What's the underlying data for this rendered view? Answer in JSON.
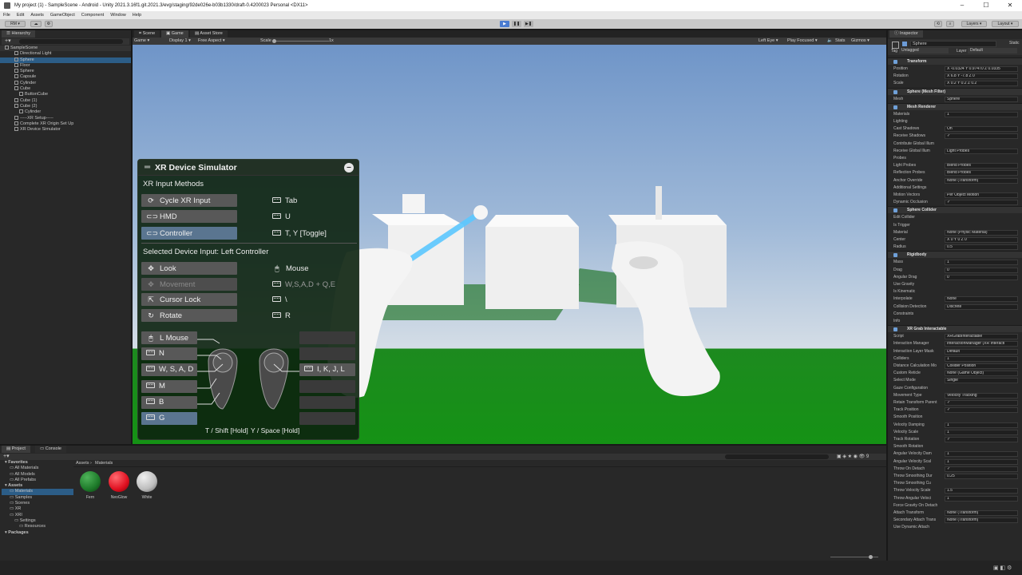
{
  "window": {
    "title": "My project (1) - SampleScene - Android - Unity 2021.3.16f1.git.2021.3/evg/staging/92de026e-b03b1330/draft-0.4200023 Personal <DX11>"
  },
  "menu": [
    "File",
    "Edit",
    "Assets",
    "GameObject",
    "Component",
    "Window",
    "Help"
  ],
  "toolbar": {
    "account": "RM",
    "layers": "Layers",
    "layout": "Layout"
  },
  "hierarchy": {
    "tab": "Hierarchy",
    "items": [
      {
        "label": "SampleScene",
        "depth": 0
      },
      {
        "label": "Directional Light",
        "depth": 2
      },
      {
        "label": "Sphere",
        "depth": 2
      },
      {
        "label": "Floor",
        "depth": 2
      },
      {
        "label": "Sphere",
        "depth": 2
      },
      {
        "label": "Capsule",
        "depth": 2
      },
      {
        "label": "Cylinder",
        "depth": 2
      },
      {
        "label": "Cube",
        "depth": 2
      },
      {
        "label": "ButtonCube",
        "depth": 3
      },
      {
        "label": "Cube (1)",
        "depth": 2
      },
      {
        "label": "Cube (2)",
        "depth": 2
      },
      {
        "label": "Cylinder",
        "depth": 3
      },
      {
        "label": "-----XR Setup-----",
        "depth": 2
      },
      {
        "label": "Complete XR Origin Set Up",
        "depth": 2
      },
      {
        "label": "XR Device Simulator",
        "depth": 2
      }
    ]
  },
  "viewtabs": {
    "scene": "Scene",
    "game": "Game",
    "asset_store": "Asset Store"
  },
  "gamebar": {
    "mode": "Game",
    "display": "Display 1",
    "aspect": "Free Aspect",
    "scale_label": "Scale",
    "scale_value": "1x",
    "eye": "Left Eye",
    "focus": "Play Focused",
    "stats": "Stats",
    "gizmos": "Gizmos"
  },
  "simulator": {
    "title": "XR Device Simulator",
    "input_methods_heading": "XR Input Methods",
    "methods": [
      {
        "label": "Cycle XR Input",
        "key": "Tab"
      },
      {
        "label": "HMD",
        "key": "U"
      },
      {
        "label": "Controller",
        "key": "T, Y [Toggle]"
      }
    ],
    "selected_heading": "Selected Device Input: Left Controller",
    "device_inputs": [
      {
        "label": "Look",
        "key": "Mouse"
      },
      {
        "label": "Movement",
        "key": "W,S,A,D + Q,E"
      },
      {
        "label": "Cursor Lock",
        "key": "\\"
      },
      {
        "label": "Rotate",
        "key": "R"
      }
    ],
    "controller_keys": [
      "L Mouse",
      "N",
      "W, S, A, D",
      "M",
      "B",
      "G"
    ],
    "right_key": "I, K, J, L",
    "footer_left": "T / Shift [Hold]",
    "footer_right": "Y / Space [Hold]"
  },
  "inspector": {
    "tab": "Inspector",
    "object_name": "Sphere",
    "static_label": "Static",
    "tag_label": "Tag",
    "tag_value": "Untagged",
    "layer_label": "Layer",
    "layer_value": "Default",
    "rows": [
      {
        "type": "head",
        "label": "Transform"
      },
      {
        "type": "row",
        "label": "Position",
        "value": "X -0.0324   Y 0.97470   Z 0.0335"
      },
      {
        "type": "row",
        "label": "Rotation",
        "value": "X 6.8   Y -7.8   Z 0"
      },
      {
        "type": "row",
        "label": "Scale",
        "value": "X 0.2   Y 0.2   Z 0.2"
      },
      {
        "type": "head",
        "label": "Sphere (Mesh Filter)"
      },
      {
        "type": "row",
        "label": "Mesh",
        "value": "Sphere"
      },
      {
        "type": "head",
        "label": "Mesh Renderer"
      },
      {
        "type": "row",
        "label": "Materials",
        "value": "1"
      },
      {
        "type": "row",
        "label": "Lighting",
        "value": ""
      },
      {
        "type": "row",
        "label": "Cast Shadows",
        "value": "On"
      },
      {
        "type": "row",
        "label": "Receive Shadows",
        "value": "✓"
      },
      {
        "type": "row",
        "label": "Contribute Global Illum",
        "value": ""
      },
      {
        "type": "row",
        "label": "Receive Global Illum",
        "value": "Light Probes"
      },
      {
        "type": "row",
        "label": "Probes",
        "value": ""
      },
      {
        "type": "row",
        "label": "Light Probes",
        "value": "Blend Probes"
      },
      {
        "type": "row",
        "label": "Reflection Probes",
        "value": "Blend Probes"
      },
      {
        "type": "row",
        "label": "Anchor Override",
        "value": "None (Transform)"
      },
      {
        "type": "row",
        "label": "Additional Settings",
        "value": ""
      },
      {
        "type": "row",
        "label": "Motion Vectors",
        "value": "Per Object Motion"
      },
      {
        "type": "row",
        "label": "Dynamic Occlusion",
        "value": "✓"
      },
      {
        "type": "head",
        "label": "Sphere Collider"
      },
      {
        "type": "row",
        "label": "Edit Collider",
        "value": ""
      },
      {
        "type": "row",
        "label": "Is Trigger",
        "value": ""
      },
      {
        "type": "row",
        "label": "Material",
        "value": "None (Physic Material)"
      },
      {
        "type": "row",
        "label": "Center",
        "value": "X 0   Y 0   Z 0"
      },
      {
        "type": "row",
        "label": "Radius",
        "value": "0.5"
      },
      {
        "type": "head",
        "label": "Rigidbody"
      },
      {
        "type": "row",
        "label": "Mass",
        "value": "1"
      },
      {
        "type": "row",
        "label": "Drag",
        "value": "0"
      },
      {
        "type": "row",
        "label": "Angular Drag",
        "value": "0"
      },
      {
        "type": "row",
        "label": "Use Gravity",
        "value": ""
      },
      {
        "type": "row",
        "label": "Is Kinematic",
        "value": ""
      },
      {
        "type": "row",
        "label": "Interpolate",
        "value": "None"
      },
      {
        "type": "row",
        "label": "Collision Detection",
        "value": "Discrete"
      },
      {
        "type": "row",
        "label": "Constraints",
        "value": ""
      },
      {
        "type": "row",
        "label": "Info",
        "value": ""
      },
      {
        "type": "head",
        "label": "XR Grab Interactable"
      },
      {
        "type": "row",
        "label": "Script",
        "value": "XRGrabInteractable"
      },
      {
        "type": "row",
        "label": "Interaction Manager",
        "value": "InteractionManager (XR Interacti"
      },
      {
        "type": "row",
        "label": "Interaction Layer Mask",
        "value": "Default"
      },
      {
        "type": "row",
        "label": "Colliders",
        "value": "1"
      },
      {
        "type": "row",
        "label": "Distance Calculation Mo",
        "value": "Collider Position"
      },
      {
        "type": "row",
        "label": "Custom Reticle",
        "value": "None (Game Object)"
      },
      {
        "type": "row",
        "label": "Select Mode",
        "value": "Single"
      },
      {
        "type": "row",
        "label": "Gaze Configuration",
        "value": ""
      },
      {
        "type": "row",
        "label": "Movement Type",
        "value": "Velocity Tracking"
      },
      {
        "type": "row",
        "label": "Retain Transform Parent",
        "value": "✓"
      },
      {
        "type": "row",
        "label": "Track Position",
        "value": "✓"
      },
      {
        "type": "row",
        "label": "Smooth Position",
        "value": ""
      },
      {
        "type": "row",
        "label": "Velocity Damping",
        "value": "1"
      },
      {
        "type": "row",
        "label": "Velocity Scale",
        "value": "1"
      },
      {
        "type": "row",
        "label": "Track Rotation",
        "value": "✓"
      },
      {
        "type": "row",
        "label": "Smooth Rotation",
        "value": ""
      },
      {
        "type": "row",
        "label": "Angular Velocity Dam",
        "value": "1"
      },
      {
        "type": "row",
        "label": "Angular Velocity Scal",
        "value": "1"
      },
      {
        "type": "row",
        "label": "Throw On Detach",
        "value": "✓"
      },
      {
        "type": "row",
        "label": "Throw Smoothing Dur",
        "value": "0.25"
      },
      {
        "type": "row",
        "label": "Throw Smoothing Cu",
        "value": ""
      },
      {
        "type": "row",
        "label": "Throw Velocity Scale",
        "value": "1.5"
      },
      {
        "type": "row",
        "label": "Throw Angular Veloci",
        "value": "1"
      },
      {
        "type": "row",
        "label": "Force Gravity On Detach",
        "value": ""
      },
      {
        "type": "row",
        "label": "Attach Transform",
        "value": "None (Transform)"
      },
      {
        "type": "row",
        "label": "Secondary Attach Trans",
        "value": "None (Transform)"
      },
      {
        "type": "row",
        "label": "Use Dynamic Attach",
        "value": ""
      }
    ]
  },
  "project": {
    "tabs": [
      "Project",
      "Console"
    ],
    "breadcrumb": [
      "Assets",
      "Materials"
    ],
    "tree": [
      {
        "label": "Favorites",
        "depth": 0
      },
      {
        "label": "All Materials",
        "depth": 1
      },
      {
        "label": "All Models",
        "depth": 1
      },
      {
        "label": "All Prefabs",
        "depth": 1
      },
      {
        "label": "Assets",
        "depth": 0
      },
      {
        "label": "Materials",
        "depth": 1
      },
      {
        "label": "Samples",
        "depth": 1
      },
      {
        "label": "Scenes",
        "depth": 1
      },
      {
        "label": "XR",
        "depth": 1
      },
      {
        "label": "XRI",
        "depth": 1
      },
      {
        "label": "Settings",
        "depth": 2
      },
      {
        "label": "Resources",
        "depth": 3
      },
      {
        "label": "Packages",
        "depth": 0
      }
    ],
    "materials": [
      {
        "label": "Fern",
        "color": "#1e7a2a"
      },
      {
        "label": "NeoGlow",
        "color": "#e01020"
      },
      {
        "label": "White",
        "color": "#bdbdbd"
      }
    ]
  }
}
